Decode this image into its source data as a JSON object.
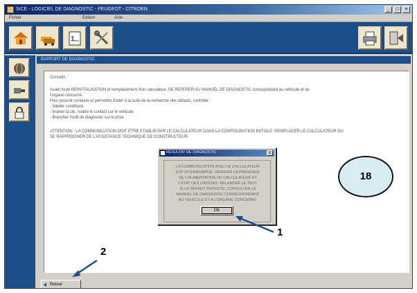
{
  "window": {
    "title": "SICE - LOGICIEL DE DIAGNOSTIC - PEUGEOT - CITROEN",
    "menu": [
      "Fichier",
      "Edition",
      "Aide"
    ]
  },
  "toolbar": {
    "buttons": [
      "home-icon",
      "cars-icon",
      "document-icon",
      "tools-icon"
    ],
    "right_buttons": [
      "printer-icon",
      "exit-icon"
    ]
  },
  "sidebar": {
    "buttons": [
      "globe-icon",
      "connector-icon",
      "lock-icon"
    ]
  },
  "panel": {
    "title": "RAPPORT DE DIAGNOSTIC",
    "content_lines": [
      "Conseils :",
      "",
      "Avant toute REINITIALISATION et remplacement d'un calculateur, SE REFERER AU MANUEL DE DIAGNOSTIC correspondant au véhicule et de",
      "l'organe concerné.",
      "Pour pouvoir conduire et permettre d'aller à la suite de la recherche des défauts, contrôler :",
      "- Valider conditions",
      "- Insérer la clé, mettre le contact sur le véhicule",
      "- Brancher l'outil de diagnostic sur la prise",
      "",
      "ATTENTION : LA COMMUNICATION DOIT ETRE ETABLIE PAR LE CALCULATEUR DANS LA CONFIGURATION INITIALE. REMPLACER LE CALCULATEUR OU",
      "SE RAPPROCHER DE L'ASSISTANCE TECHNIQUE DE CONSTRUCTEUR."
    ]
  },
  "dialog": {
    "title": "RESULTAT DE DIAGNOSTIC",
    "close_label": "x",
    "lines": [
      "LA COMMUNICATION AVEC LE CALCULATEUR",
      "EST INTERROMPUE. VERIFIER LA PRESENCE",
      "DE L'ALIMENTATION DU CALCULATEUR ET",
      "L'ETAT DES LIAISONS. RELANCER LE TEST.",
      "SI LE DEFAUT PERSISTE, CONSULTER LE",
      "MANUEL DE DIAGNOSTIC CORRESPONDANT",
      "AU VEHICULE ET A L'ORGANE CONCERNE."
    ],
    "ok_label": "OK"
  },
  "annotations": {
    "step_number": "18",
    "callout_1": "1",
    "callout_2": "2"
  },
  "footer": {
    "back_label": "Retour"
  }
}
